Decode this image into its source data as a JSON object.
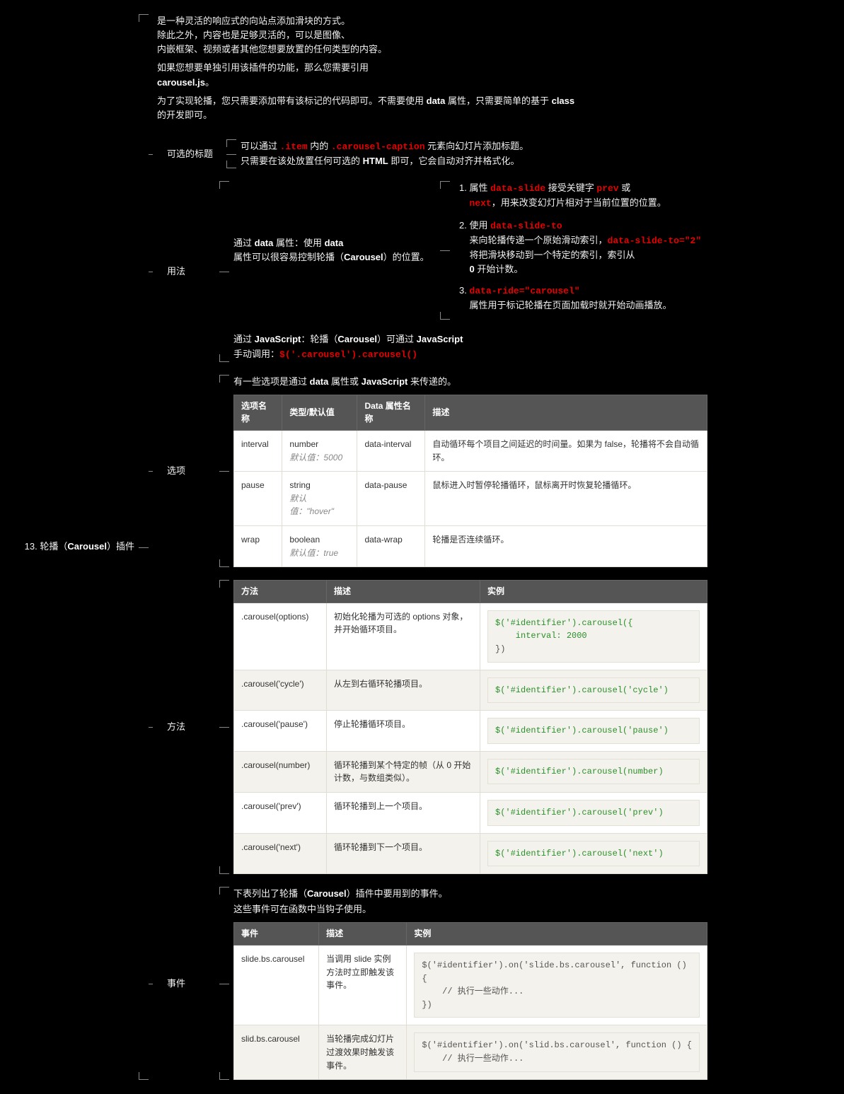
{
  "root_number": "13.",
  "root_title_pre": "轮播（",
  "root_title_bold": "Carousel",
  "root_title_post": "）插件",
  "intro": {
    "p1a": "是一种灵活的响应式的向站点添加滑块的方式。",
    "p1b": "除此之外，内容也是足够灵活的，可以是图像、",
    "p1c": "内嵌框架、视频或者其他您想要放置的任何类型的内容。",
    "p2a": "如果您想要单独引用该插件的功能，那么您需要引用",
    "p2b": "carousel.js",
    "p2c": "。",
    "p3a": "为了实现轮播，您只需要添加带有该标记的代码即可。不需要使用 ",
    "p3b": "data",
    "p3c": " 属性，只需要简单的基于 ",
    "p3d": "class",
    "p3e": " 的开发即可。"
  },
  "captions": {
    "label": "可选的标题",
    "line1a": "可以通过 ",
    "line1b": ".item",
    "line1c": " 内的 ",
    "line1d": ".carousel-caption",
    "line1e": " 元素向幻灯片添加标题。",
    "line2a": "只需要在该处放置任何可选的 ",
    "line2b": "HTML",
    "line2c": " 即可，它会自动对齐并格式化。"
  },
  "usage": {
    "label": "用法",
    "data_intro_a": "通过 ",
    "data_intro_b": "data",
    "data_intro_c": " 属性：使用 ",
    "data_intro_d": "data",
    "data_intro_e": " 属性可以很容易控制轮播（",
    "data_intro_f": "Carousel",
    "data_intro_g": "）的位置。",
    "li1_a": "属性 ",
    "li1_b": "data-slide",
    "li1_c": " 接受关键字 ",
    "li1_d": "prev",
    "li1_e": " 或 ",
    "li1_f": "next",
    "li1_g": "，用来改变幻灯片相对于当前位置的位置。",
    "li2_a": "使用 ",
    "li2_b": "data-slide-to",
    "li2_c": " 来向轮播传递一个原始滑动索引，",
    "li2_d": "data-slide-to=\"2\"",
    "li2_e": " 将把滑块移动到一个特定的索引，索引从 ",
    "li2_f": "0",
    "li2_g": " 开始计数。",
    "li3_a": "data-ride=\"carousel\"",
    "li3_b": " 属性用于标记轮播在页面加载时就开始动画播放。",
    "js_intro_a": "通过 ",
    "js_intro_b": "JavaScript",
    "js_intro_c": "：轮播（",
    "js_intro_d": "Carousel",
    "js_intro_e": "）可通过 ",
    "js_intro_f": "JavaScript",
    "js_intro_g": " 手动调用：",
    "js_intro_h": "$('.carousel').carousel()"
  },
  "options": {
    "label": "选项",
    "intro_a": "有一些选项是通过 ",
    "intro_b": "data",
    "intro_c": " 属性或 ",
    "intro_d": "JavaScript",
    "intro_e": " 来传递的。",
    "th_name": "选项名称",
    "th_type": "类型/默认值",
    "th_data": "Data 属性名称",
    "th_desc": "描述",
    "rows": [
      {
        "name": "interval",
        "type": "number",
        "def": "默认值：5000",
        "data": "data-interval",
        "desc": "自动循环每个项目之间延迟的时间量。如果为 false，轮播将不会自动循环。"
      },
      {
        "name": "pause",
        "type": "string",
        "def": "默认值：\"hover\"",
        "data": "data-pause",
        "desc": "鼠标进入时暂停轮播循环，鼠标离开时恢复轮播循环。"
      },
      {
        "name": "wrap",
        "type": "boolean",
        "def": "默认值：true",
        "data": "data-wrap",
        "desc": "轮播是否连续循环。"
      }
    ]
  },
  "methods": {
    "label": "方法",
    "th_method": "方法",
    "th_desc": "描述",
    "th_ex": "实例",
    "rows": [
      {
        "name": ".carousel(options)",
        "desc": "初始化轮播为可选的 options 对象，并开始循环项目。",
        "ex1": "$('#identifier').carousel({",
        "ex2": "    interval: 2000",
        "ex3": "})"
      },
      {
        "name": ".carousel('cycle')",
        "desc": "从左到右循环轮播项目。",
        "ex1": "$('#identifier').carousel('cycle')"
      },
      {
        "name": ".carousel('pause')",
        "desc": "停止轮播循环项目。",
        "ex1": "$('#identifier').carousel('pause')"
      },
      {
        "name": ".carousel(number)",
        "desc": "循环轮播到某个特定的帧（从 0 开始计数，与数组类似）。",
        "ex1": "$('#identifier').carousel(number)"
      },
      {
        "name": ".carousel('prev')",
        "desc": "循环轮播到上一个项目。",
        "ex1": "$('#identifier').carousel('prev')"
      },
      {
        "name": ".carousel('next')",
        "desc": "循环轮播到下一个项目。",
        "ex1": "$('#identifier').carousel('next')"
      }
    ]
  },
  "events": {
    "label": "事件",
    "intro_a": "下表列出了轮播（",
    "intro_b": "Carousel",
    "intro_c": "）插件中要用到的事件。",
    "intro2": "这些事件可在函数中当钩子使用。",
    "th_event": "事件",
    "th_desc": "描述",
    "th_ex": "实例",
    "rows": [
      {
        "name": "slide.bs.carousel",
        "desc": "当调用 slide 实例方法时立即触发该事件。",
        "ex": "$('#identifier').on('slide.bs.carousel', function ()\n{\n    // 执行一些动作...\n})"
      },
      {
        "name": "slid.bs.carousel",
        "desc": "当轮播完成幻灯片过渡效果时触发该事件。",
        "ex": "$('#identifier').on('slid.bs.carousel', function () {\n    // 执行一些动作..."
      }
    ]
  }
}
